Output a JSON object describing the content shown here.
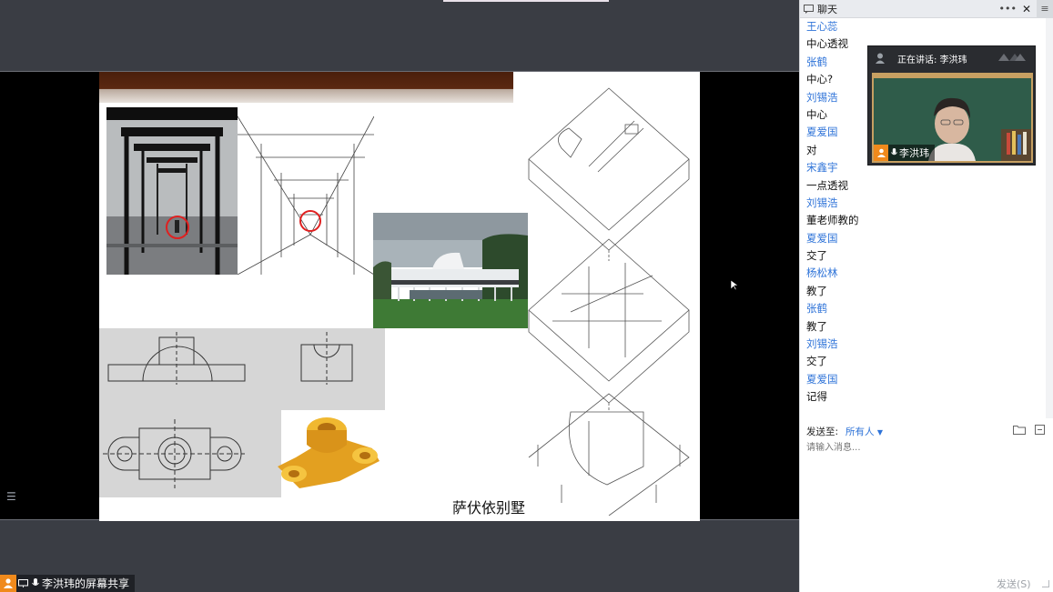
{
  "window": {
    "panel_title": "聊天"
  },
  "share": {
    "status_label": "李洪玮的屏幕共享",
    "slide_caption": "萨伏依别墅"
  },
  "video": {
    "speaking_label": "正在讲话: 李洪玮",
    "participant_name": "李洪玮"
  },
  "chat": {
    "lines": [
      {
        "kind": "sender",
        "text": "王心蕊"
      },
      {
        "kind": "text",
        "text": "中心透视"
      },
      {
        "kind": "sender",
        "text": "张鹤"
      },
      {
        "kind": "text",
        "text": "中心?"
      },
      {
        "kind": "sender",
        "text": "刘锡浩"
      },
      {
        "kind": "text",
        "text": "中心"
      },
      {
        "kind": "sender",
        "text": "夏爱国"
      },
      {
        "kind": "text",
        "text": "对"
      },
      {
        "kind": "sender",
        "text": "宋鑫宇"
      },
      {
        "kind": "text",
        "text": "一点透视"
      },
      {
        "kind": "sender",
        "text": "刘锡浩"
      },
      {
        "kind": "text",
        "text": "董老师教的"
      },
      {
        "kind": "sender",
        "text": "夏爱国"
      },
      {
        "kind": "text",
        "text": "交了"
      },
      {
        "kind": "sender",
        "text": "杨松林"
      },
      {
        "kind": "text",
        "text": "教了"
      },
      {
        "kind": "sender",
        "text": "张鹤"
      },
      {
        "kind": "text",
        "text": "教了"
      },
      {
        "kind": "sender",
        "text": "刘锡浩"
      },
      {
        "kind": "text",
        "text": "交了"
      },
      {
        "kind": "sender",
        "text": "夏爱国"
      },
      {
        "kind": "text",
        "text": "记得"
      }
    ],
    "send_to_label": "发送至:",
    "recipient": "所有人",
    "input_placeholder": "请输入消息...",
    "send_button": "发送(S)"
  },
  "colors": {
    "sender_name": "#2e73d8",
    "accent_orange": "#f08a1c",
    "panel_bg": "#ffffff",
    "desktop_bg": "#3a3d44"
  }
}
